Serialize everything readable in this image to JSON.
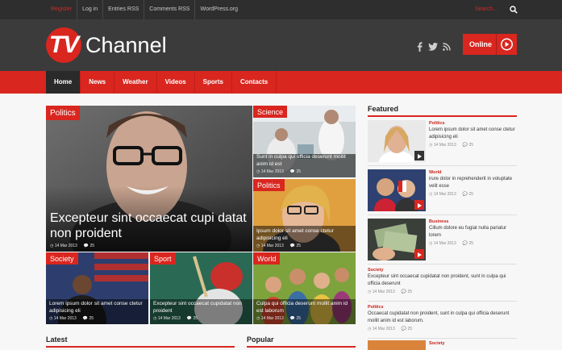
{
  "topbar": {
    "links": [
      "Register",
      "Log in",
      "Entries RSS",
      "Comments RSS",
      "WordPress.org"
    ],
    "search_placeholder": "Search..."
  },
  "header": {
    "logo_mark": "TV",
    "logo_text": "Channel",
    "online_label": "Online"
  },
  "nav": {
    "items": [
      "Home",
      "News",
      "Weather",
      "Videos",
      "Sports",
      "Contacts"
    ],
    "active": "Home"
  },
  "tiles": {
    "main": {
      "tag": "Politics",
      "title": "Excepteur sint occaecat cupi datat non proident",
      "date": "14 Mar 2013",
      "comments": "25"
    },
    "science": {
      "tag": "Science",
      "title": "Sunt in culpa qui officia deserunt mollit anim id est",
      "date": "14 Mar 2013",
      "comments": "25"
    },
    "politics2": {
      "tag": "Politics",
      "title": "Ipsum dolor sit amet conse ctetur adipisicing eli",
      "date": "14 Mar 2013",
      "comments": "25"
    },
    "society": {
      "tag": "Society",
      "title": "Lorem ipsum dolor sit amet conse ctetur adipisicing eli",
      "date": "14 Mar 2013",
      "comments": "25"
    },
    "sport": {
      "tag": "Sport",
      "title": "Excepteur sint occaecat cupidatat non proident",
      "date": "14 Mar 2013",
      "comments": "25"
    },
    "world": {
      "tag": "World",
      "title": "Culpa qui officia deserunt mollit anim id est laborum",
      "date": "14 Mar 2013",
      "comments": "25"
    }
  },
  "sections": {
    "featured": "Featured",
    "latest": "Latest",
    "popular": "Popular"
  },
  "featured": [
    {
      "cat": "Politics",
      "title": "Lorem ipsum dolor sit amet conse ctetur adipisicing eli",
      "date": "14 Mar 2013",
      "comments": "25"
    },
    {
      "cat": "World",
      "title": "irure dolor in reprehenderit in voluptate velit esse",
      "date": "14 Mar 2013",
      "comments": "25"
    },
    {
      "cat": "Business",
      "title": "Cillum dolore eu fugiat nulla pariatur lorem",
      "date": "14 Mar 2013",
      "comments": "25"
    }
  ],
  "featured_text": [
    {
      "cat": "Society",
      "title": "Excepteur sint occaecat cupidatat non proident, sunt in culpa qui officia deserunt",
      "date": "14 Mar 2013",
      "comments": "25"
    },
    {
      "cat": "Politics",
      "title": "Occaecat cupidatat non proident, sunt in culpa qui officia deserunt mollit anim id est laborum.",
      "date": "14 Mar 2013",
      "comments": "25"
    },
    {
      "cat": "Society"
    }
  ],
  "colors": {
    "brand": "#d9261f",
    "dark": "#2e2e2e"
  }
}
